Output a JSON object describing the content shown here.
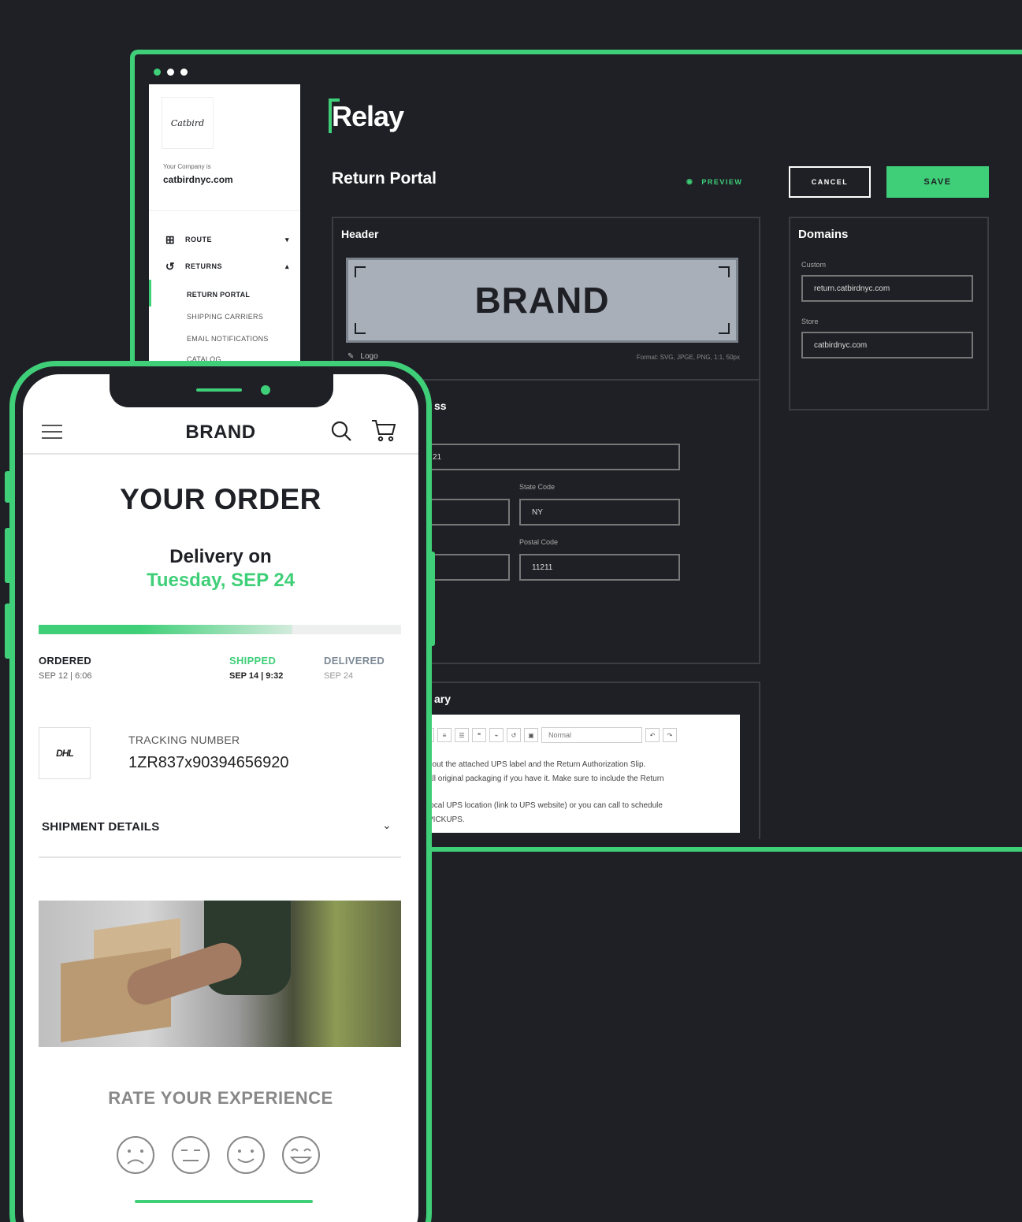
{
  "colors": {
    "accent": "#3fcf78",
    "background": "#1e2025",
    "panel_border": "#3a3d44"
  },
  "desktop": {
    "sidebar": {
      "logo_text": "Catbird",
      "company_label": "Your Company is",
      "company_url": "catbirdnyc.com",
      "nav": [
        {
          "label": "ROUTE",
          "icon": "route-icon",
          "chevron": "▾"
        },
        {
          "label": "RETURNS",
          "icon": "returns-icon",
          "chevron": "▴"
        }
      ],
      "sub_items": [
        "RETURN PORTAL",
        "SHIPPING CARRIERS",
        "EMAIL NOTIFICATIONS",
        "CATALOG"
      ]
    },
    "app_name": "Relay",
    "page_title": "Return Portal",
    "preview_label": "PREVIEW",
    "cancel_label": "CANCEL",
    "save_label": "SAVE",
    "header_panel": {
      "title": "Header",
      "brand_placeholder": "BRAND",
      "logo_label": "Logo",
      "format_note": "Format: SVG, JPGE, PNG, 1:1, 50px"
    },
    "address": {
      "title_fragment": "ss",
      "address_value_fragment": "21",
      "state_label": "State Code",
      "state_value": "NY",
      "postal_label": "Postal Code",
      "postal_value": "11211"
    },
    "domains": {
      "title": "Domains",
      "custom_label": "Custom",
      "custom_value": "return.catbirdnyc.com",
      "store_label": "Store",
      "store_value": "catbirdnyc.com"
    },
    "summary": {
      "title_fragment": "ary",
      "format_select": "Normal",
      "lines": [
        "t out the attached UPS label and the Return Authorization Slip.",
        "all original packaging if you have it. Make sure to include the Return",
        "local UPS location (link to UPS website) or you can call to schedule",
        "PICKUPS."
      ]
    }
  },
  "phone": {
    "brand": "BRAND",
    "order_title": "YOUR ORDER",
    "delivery_on": "Delivery on",
    "delivery_date": "Tuesday, SEP 24",
    "progress_fraction": 0.7,
    "stages": [
      {
        "label": "ORDERED",
        "date": "SEP 12 | 6:06",
        "state": "done"
      },
      {
        "label": "SHIPPED",
        "date": "SEP 14 | 9:32",
        "state": "current"
      },
      {
        "label": "DELIVERED",
        "date": "SEP 24",
        "state": "pending"
      }
    ],
    "carrier_logo": "DHL",
    "tracking_label": "TRACKING NUMBER",
    "tracking_number": "1ZR837x90394656920",
    "shipment_details": "SHIPMENT DETAILS",
    "rate_title": "RATE YOUR EXPERIENCE",
    "ratings": [
      "very-sad-face-icon",
      "neutral-face-icon",
      "smile-face-icon",
      "big-smile-face-icon"
    ]
  }
}
